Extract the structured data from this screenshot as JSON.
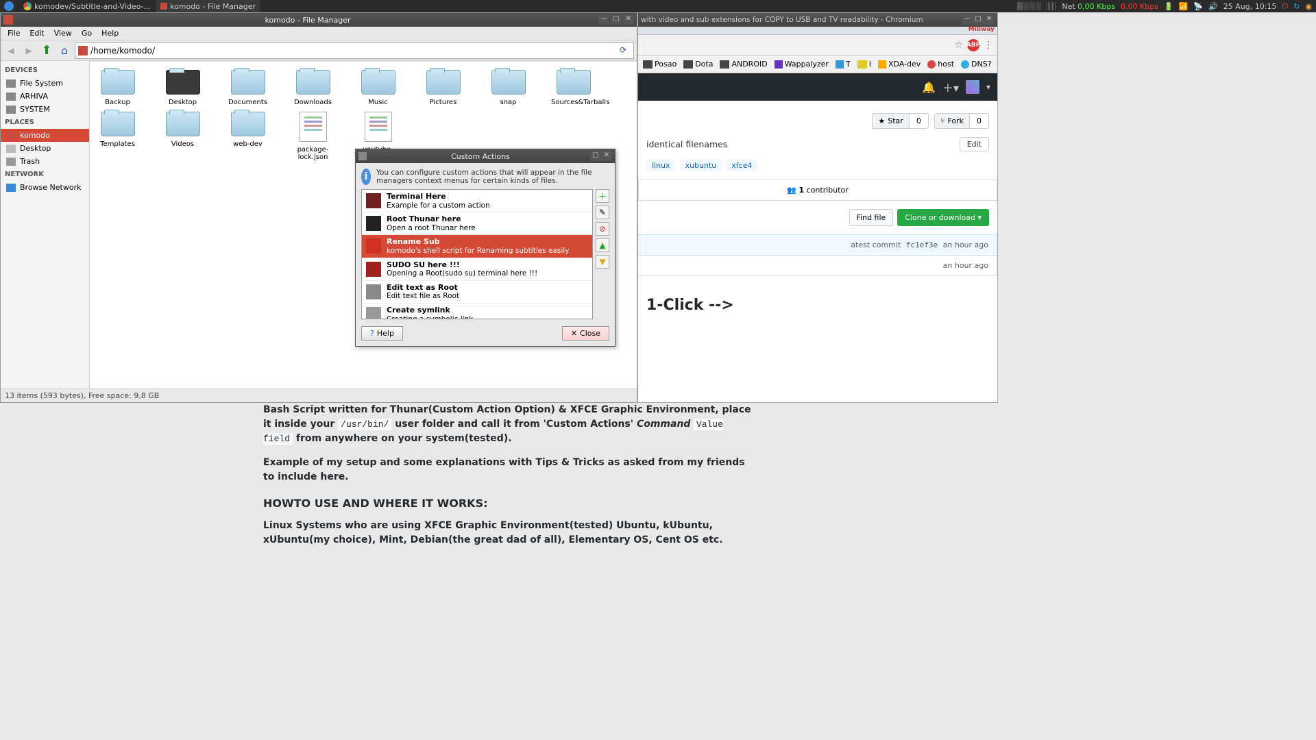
{
  "panel": {
    "task1": "komodev/Subtitle-and-Video-...",
    "task2": "komodo - File Manager",
    "net_label": "Net",
    "net_down": "0,00 Kbps",
    "net_up": "0,00 Kbps",
    "date": "25 Aug, 10:15"
  },
  "fm": {
    "title": "komodo - File Manager",
    "menu": [
      "File",
      "Edit",
      "View",
      "Go",
      "Help"
    ],
    "path": "/home/komodo/",
    "sidebar": {
      "devices_head": "DEVICES",
      "devices": [
        "File System",
        "ARHIVA",
        "SYSTEM"
      ],
      "places_head": "PLACES",
      "places": [
        "komodo",
        "Desktop",
        "Trash"
      ],
      "network_head": "NETWORK",
      "network": [
        "Browse Network"
      ]
    },
    "items": [
      "Backup",
      "Desktop",
      "Documents",
      "Downloads",
      "Music",
      "Pictures",
      "snap",
      "Sources&Tarballs",
      "Templates",
      "Videos",
      "web-dev",
      "package-lock.json",
      "youtube-dl.sig"
    ],
    "status": "13 items (593 bytes), Free space: 9,8 GB"
  },
  "dialog": {
    "title": "Custom Actions",
    "info": "You can configure custom actions that will appear in the file managers context menus for certain kinds of files.",
    "actions": [
      {
        "name": "Terminal Here",
        "desc": "Example for a custom action"
      },
      {
        "name": "Root Thunar here",
        "desc": "Open a root Thunar here"
      },
      {
        "name": "Rename Sub",
        "desc": "komodo's shell script for Renaming subtitles easily"
      },
      {
        "name": "SUDO SU here !!!",
        "desc": "Opening a Root(sudo su) terminal here !!!"
      },
      {
        "name": "Edit text as Root",
        "desc": "Edit text file as Root"
      },
      {
        "name": "Create symlink",
        "desc": "Creating a symbolic link"
      }
    ],
    "help": "Help",
    "close": "Close"
  },
  "chrome": {
    "title": "with video and sub extensions for COPY to USB and TV readability - Chromium",
    "bookmarks": [
      "Posao",
      "Dota",
      "ANDROID",
      "Wappalyzer",
      "T",
      "I",
      "XDA-dev",
      "host",
      "DNS?"
    ],
    "star_label": "Star",
    "star_count": "0",
    "fork_label": "Fork",
    "fork_count": "0",
    "desc": "identical filenames",
    "edit": "Edit",
    "tags": [
      "linux",
      "xubuntu",
      "xfce4"
    ],
    "contrib_count": "1",
    "contrib_label": "contributor",
    "findfile": "Find file",
    "clone": "Clone or download",
    "commit_prefix": "atest commit",
    "commit_sha": "fc1ef3e",
    "commit_time": "an hour ago",
    "file_time": "an hour ago",
    "readme_h": "1-Click -->"
  },
  "readme": {
    "p1a": "Bash Script written for Thunar(Custom Action Option) & XFCE Graphic Environment, place it inside your ",
    "p1_code1": "/usr/bin/",
    "p1b": " user folder and call it from 'Custom Actions' ",
    "p1_em": "Command",
    "p1_code2": "Value field",
    "p1c": " from anywhere on your system(tested).",
    "p2": "Example of my setup and some explanations with Tips & Tricks as asked from my friends to include here.",
    "h3": "HOWTO USE AND WHERE IT WORKS:",
    "p3": "Linux Systems who are using XFCE Graphic Environment(tested) Ubuntu, kUbuntu, xUbuntu(my choice), Mint, Debian(the great dad of all), Elementary OS, Cent OS etc."
  }
}
